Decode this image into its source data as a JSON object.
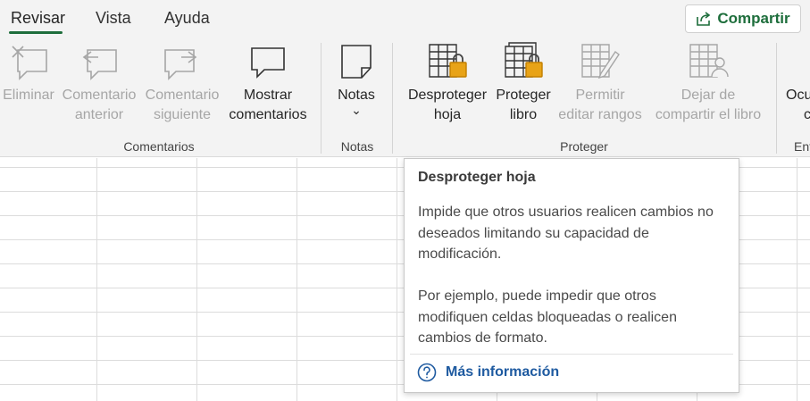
{
  "tabs": [
    {
      "label": "Revisar",
      "active": true
    },
    {
      "label": "Vista",
      "active": false
    },
    {
      "label": "Ayuda",
      "active": false
    }
  ],
  "share": {
    "label": "Compartir",
    "icon": "share-icon"
  },
  "ribbon": {
    "comentarios": {
      "group_label": "Comentarios",
      "buttons": [
        {
          "label": "Eliminar",
          "icon": "delete-comment-icon",
          "disabled": true
        },
        {
          "label": "Comentario\nanterior",
          "icon": "previous-comment-icon",
          "disabled": true
        },
        {
          "label": "Comentario\nsiguiente",
          "icon": "next-comment-icon",
          "disabled": true
        },
        {
          "label": "Mostrar\ncomentarios",
          "icon": "show-comments-icon",
          "disabled": false
        }
      ]
    },
    "notas": {
      "group_label": "Notas",
      "button": {
        "label": "Notas",
        "icon": "note-icon",
        "dropdown": "⌄"
      }
    },
    "proteger": {
      "group_label": "Proteger",
      "buttons": [
        {
          "label": "Desproteger\nhoja",
          "icon": "unprotect-sheet-icon",
          "disabled": false
        },
        {
          "label": "Proteger\nlibro",
          "icon": "protect-workbook-icon",
          "disabled": false
        },
        {
          "label": "Permitir\neditar rangos",
          "icon": "allow-edit-ranges-icon",
          "disabled": true
        },
        {
          "label": "Dejar de\ncompartir el libro",
          "icon": "unshare-workbook-icon",
          "disabled": true
        }
      ]
    },
    "clipped": {
      "label_line1": "Ocu",
      "label_line2": "c",
      "group_label": "Ent"
    }
  },
  "tooltip": {
    "title": "Desproteger hoja",
    "paragraph1": "Impide que otros usuarios realicen cambios no deseados limitando su capacidad de modificación.",
    "paragraph2": "Por ejemplo, puede impedir que otros modifiquen celdas bloqueadas o realicen cambios de formato.",
    "link": "Más información",
    "link_icon": "help-icon"
  },
  "colors": {
    "accent_green": "#1e6e3c",
    "link_blue": "#1e5aa0",
    "lock_gold": "#e8a317",
    "ribbon_bg": "#f3f3f3"
  }
}
